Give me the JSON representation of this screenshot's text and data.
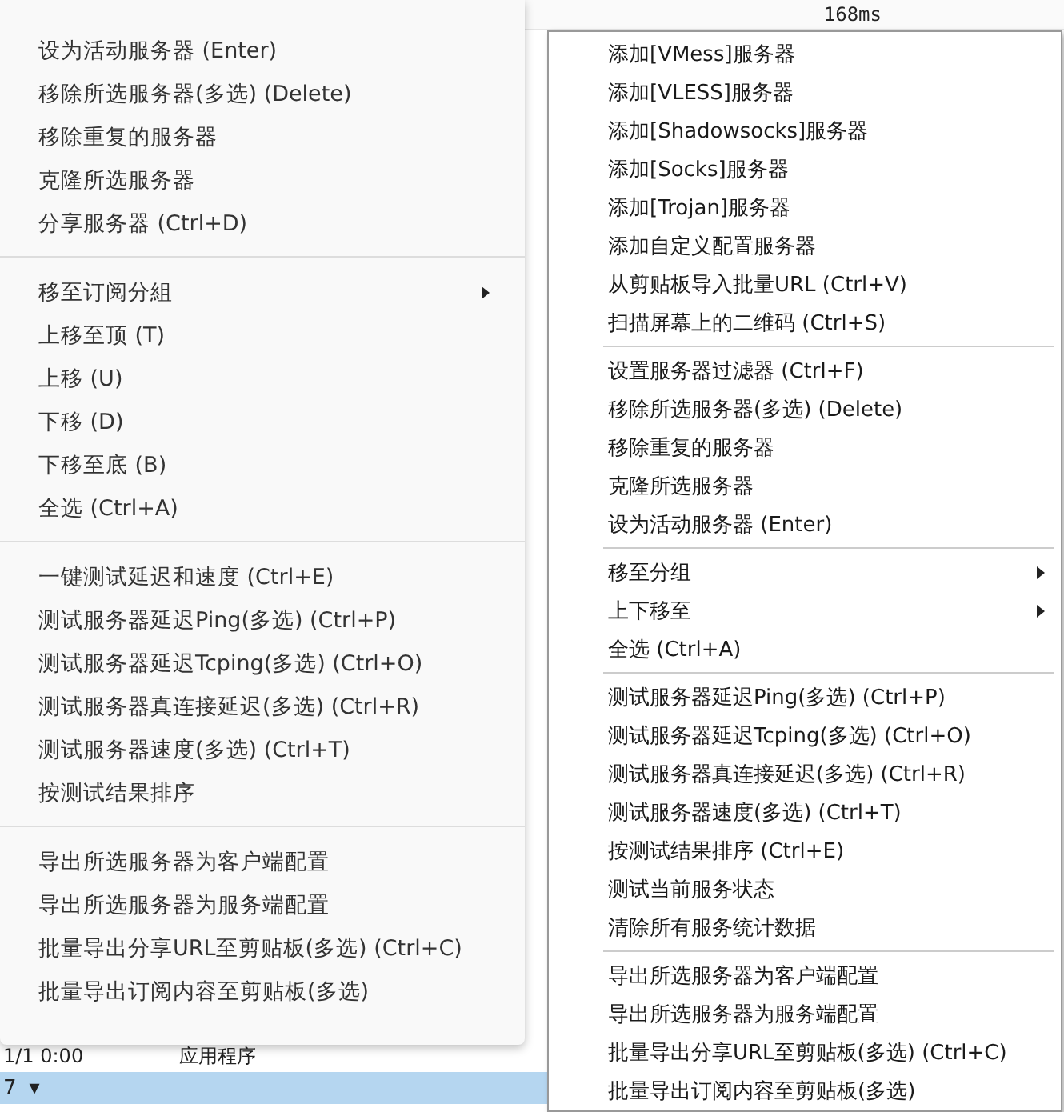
{
  "background": {
    "latency_cell": "168ms",
    "last_row": {
      "time": "1/1 0:00",
      "type": "应用程序"
    },
    "status_bar": {
      "value": "7",
      "caret": "▾"
    }
  },
  "menus": [
    {
      "sections": [
        [
          {
            "label": "设为活动服务器 (Enter)",
            "submenu": false
          },
          {
            "label": "移除所选服务器(多选) (Delete)",
            "submenu": false
          },
          {
            "label": "移除重复的服务器",
            "submenu": false
          },
          {
            "label": "克隆所选服务器",
            "submenu": false
          },
          {
            "label": "分享服务器 (Ctrl+D)",
            "submenu": false
          }
        ],
        [
          {
            "label": "移至订阅分組",
            "submenu": true
          },
          {
            "label": "上移至顶 (T)",
            "submenu": false
          },
          {
            "label": "上移 (U)",
            "submenu": false
          },
          {
            "label": "下移 (D)",
            "submenu": false
          },
          {
            "label": "下移至底 (B)",
            "submenu": false
          },
          {
            "label": "全选 (Ctrl+A)",
            "submenu": false
          }
        ],
        [
          {
            "label": "一键测试延迟和速度 (Ctrl+E)",
            "submenu": false
          },
          {
            "label": "测试服务器延迟Ping(多选) (Ctrl+P)",
            "submenu": false
          },
          {
            "label": "测试服务器延迟Tcping(多选) (Ctrl+O)",
            "submenu": false
          },
          {
            "label": "测试服务器真连接延迟(多选) (Ctrl+R)",
            "submenu": false
          },
          {
            "label": "测试服务器速度(多选) (Ctrl+T)",
            "submenu": false
          },
          {
            "label": "按测试结果排序",
            "submenu": false
          }
        ],
        [
          {
            "label": "导出所选服务器为客户端配置",
            "submenu": false
          },
          {
            "label": "导出所选服务器为服务端配置",
            "submenu": false
          },
          {
            "label": "批量导出分享URL至剪贴板(多选) (Ctrl+C)",
            "submenu": false
          },
          {
            "label": "批量导出订阅内容至剪贴板(多选)",
            "submenu": false
          }
        ]
      ]
    },
    {
      "sections": [
        [
          {
            "label": "添加[VMess]服务器",
            "submenu": false
          },
          {
            "label": "添加[VLESS]服务器",
            "submenu": false
          },
          {
            "label": "添加[Shadowsocks]服务器",
            "submenu": false
          },
          {
            "label": "添加[Socks]服务器",
            "submenu": false
          },
          {
            "label": "添加[Trojan]服务器",
            "submenu": false
          },
          {
            "label": "添加自定义配置服务器",
            "submenu": false
          },
          {
            "label": "从剪贴板导入批量URL (Ctrl+V)",
            "submenu": false
          },
          {
            "label": "扫描屏幕上的二维码 (Ctrl+S)",
            "submenu": false
          }
        ],
        [
          {
            "label": "设置服务器过滤器 (Ctrl+F)",
            "submenu": false
          },
          {
            "label": "移除所选服务器(多选) (Delete)",
            "submenu": false
          },
          {
            "label": "移除重复的服务器",
            "submenu": false
          },
          {
            "label": "克隆所选服务器",
            "submenu": false
          },
          {
            "label": "设为活动服务器 (Enter)",
            "submenu": false
          }
        ],
        [
          {
            "label": "移至分组",
            "submenu": true
          },
          {
            "label": "上下移至",
            "submenu": true
          },
          {
            "label": "全选 (Ctrl+A)",
            "submenu": false
          }
        ],
        [
          {
            "label": "测试服务器延迟Ping(多选) (Ctrl+P)",
            "submenu": false
          },
          {
            "label": "测试服务器延迟Tcping(多选) (Ctrl+O)",
            "submenu": false
          },
          {
            "label": "测试服务器真连接延迟(多选) (Ctrl+R)",
            "submenu": false
          },
          {
            "label": "测试服务器速度(多选) (Ctrl+T)",
            "submenu": false
          },
          {
            "label": "按测试结果排序 (Ctrl+E)",
            "submenu": false
          },
          {
            "label": "测试当前服务状态",
            "submenu": false
          },
          {
            "label": "清除所有服务统计数据",
            "submenu": false
          }
        ],
        [
          {
            "label": "导出所选服务器为客户端配置",
            "submenu": false
          },
          {
            "label": "导出所选服务器为服务端配置",
            "submenu": false
          },
          {
            "label": "批量导出分享URL至剪贴板(多选) (Ctrl+C)",
            "submenu": false
          },
          {
            "label": "批量导出订阅内容至剪贴板(多选)",
            "submenu": false
          }
        ]
      ]
    }
  ]
}
